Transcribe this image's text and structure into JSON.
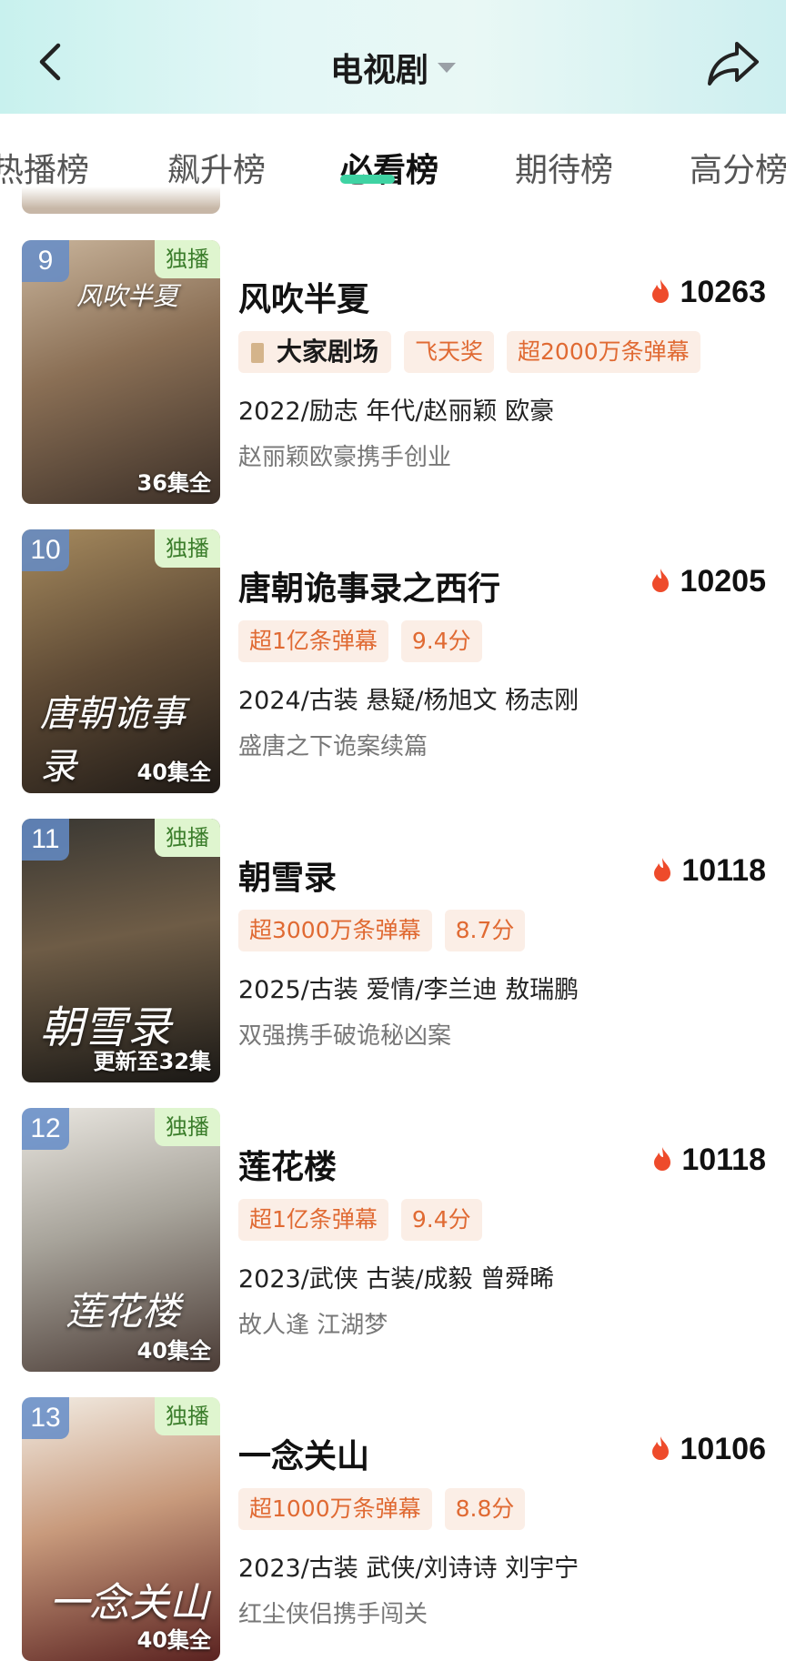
{
  "header": {
    "title": "电视剧"
  },
  "tabs": [
    "热播榜",
    "飙升榜",
    "必看榜",
    "期待榜",
    "高分榜"
  ],
  "active_tab": "必看榜",
  "colors": {
    "accent": "#3fd3a3",
    "badge_bg": "#fbeee6",
    "badge_text": "#e06a33",
    "exclusive_bg": "#dff5cf",
    "flame": "#ee4b2b"
  },
  "shows": [
    {
      "rank": "9",
      "exclusive": "独播",
      "episodes": "36集全",
      "title": "风吹半夏",
      "heat": "10263",
      "badges": [
        "大家剧场",
        "飞天奖",
        "超2000万条弹幕"
      ],
      "meta": "2022/励志 年代/赵丽颖 欧豪",
      "desc": "赵丽颖欧豪携手创业",
      "poster_title": "风吹半夏"
    },
    {
      "rank": "10",
      "exclusive": "独播",
      "episodes": "40集全",
      "title": "唐朝诡事录之西行",
      "heat": "10205",
      "badges": [
        "超1亿条弹幕",
        "9.4分"
      ],
      "meta": "2024/古装 悬疑/杨旭文 杨志刚",
      "desc": "盛唐之下诡案续篇",
      "poster_title": "唐朝诡事录"
    },
    {
      "rank": "11",
      "exclusive": "独播",
      "episodes": "更新至32集",
      "title": "朝雪录",
      "heat": "10118",
      "badges": [
        "超3000万条弹幕",
        "8.7分"
      ],
      "meta": "2025/古装 爱情/李兰迪 敖瑞鹏",
      "desc": "双强携手破诡秘凶案",
      "poster_title": "朝雪录"
    },
    {
      "rank": "12",
      "exclusive": "独播",
      "episodes": "40集全",
      "title": "莲花楼",
      "heat": "10118",
      "badges": [
        "超1亿条弹幕",
        "9.4分"
      ],
      "meta": "2023/武侠 古装/成毅 曾舜晞",
      "desc": "故人逢 江湖梦",
      "poster_title": "莲花楼"
    },
    {
      "rank": "13",
      "exclusive": "独播",
      "episodes": "40集全",
      "title": "一念关山",
      "heat": "10106",
      "badges": [
        "超1000万条弹幕",
        "8.8分"
      ],
      "meta": "2023/古装 武侠/刘诗诗 刘宇宁",
      "desc": "红尘侠侣携手闯关",
      "poster_title": "一念关山"
    }
  ]
}
